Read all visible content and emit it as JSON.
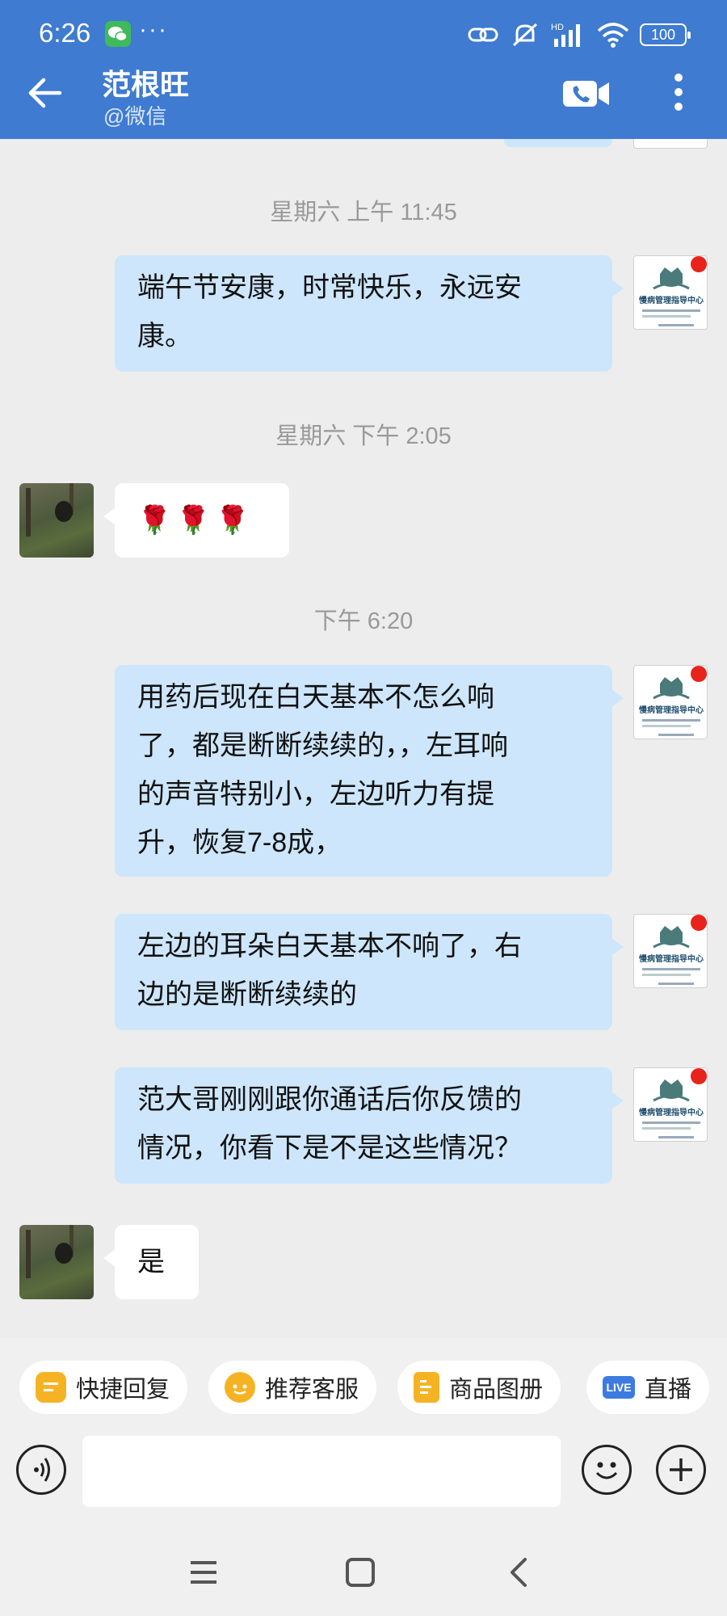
{
  "status_bar": {
    "time": "6:26",
    "dots": "···",
    "signal_label": "HD",
    "battery": "100"
  },
  "header": {
    "title": "范根旺",
    "subtitle": "@微信"
  },
  "messages": [
    {
      "type": "time",
      "text": "星期六  上午 11:45"
    },
    {
      "type": "out",
      "text": "端午节安康，时常快乐，永远安\n康。"
    },
    {
      "type": "time",
      "text": "星期六  下午 2:05"
    },
    {
      "type": "in",
      "text": "🌹🌹🌹"
    },
    {
      "type": "time",
      "text": "下午 6:20"
    },
    {
      "type": "out",
      "text": "用药后现在白天基本不怎么响\n了，都是断断续续的，，左耳响\n的声音特别小，左边听力有提\n升，恢复7-8成，"
    },
    {
      "type": "out",
      "text": "左边的耳朵白天基本不响了，右\n边的是断断续续的"
    },
    {
      "type": "out",
      "text": "范大哥刚刚跟你通话后你反馈的\n情况，你看下是不是这些情况？"
    },
    {
      "type": "in",
      "text": "是"
    }
  ],
  "avatar_out": {
    "org_name": "慢病管理指导中心"
  },
  "quick_actions": [
    {
      "label": "快捷回复",
      "icon": "quick-reply-icon",
      "color": "#f5b324"
    },
    {
      "label": "推荐客服",
      "icon": "service-icon",
      "color": "#f5b324"
    },
    {
      "label": "商品图册",
      "icon": "catalog-icon",
      "color": "#f5b324"
    },
    {
      "label": "直播",
      "icon": "live-icon",
      "color": "#3d7be0",
      "badge": "LIVE"
    }
  ],
  "input": {
    "placeholder": ""
  },
  "colors": {
    "header": "#3e7bd1",
    "bubble_out": "#cde6fb",
    "bubble_in": "#ffffff",
    "background": "#ededed"
  }
}
